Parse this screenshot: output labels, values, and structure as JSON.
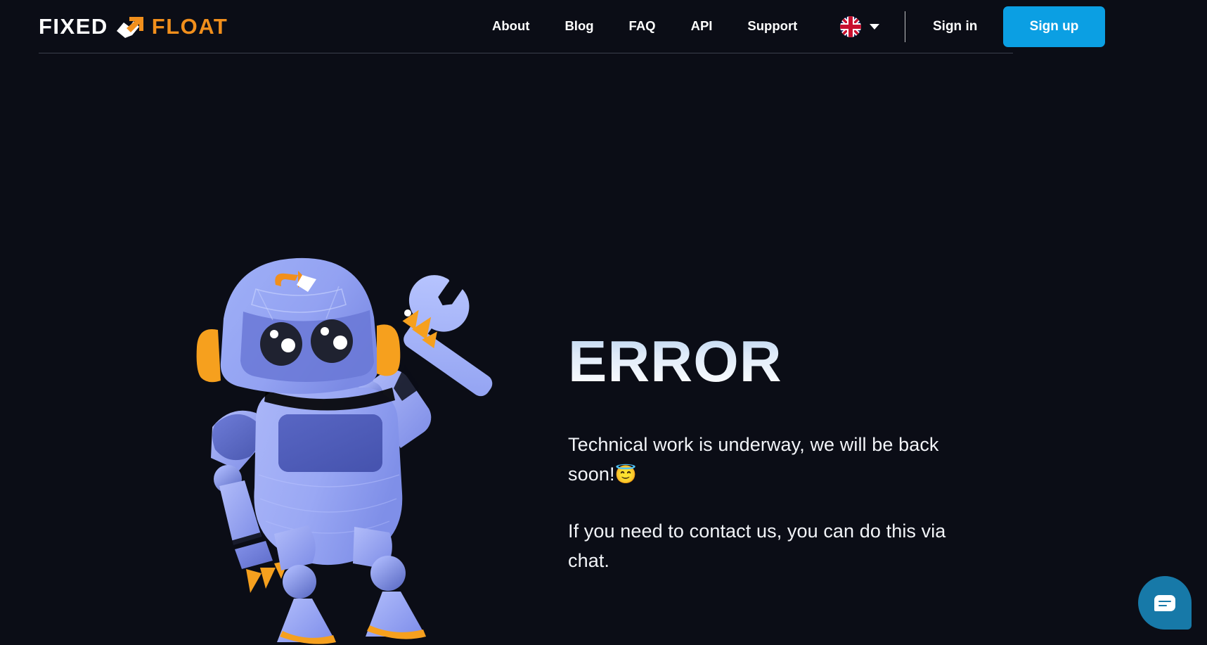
{
  "header": {
    "logo": {
      "fixed_text": "FIXED",
      "float_text": "FLOAT",
      "mark_icon": "arrow-exchange-icon"
    },
    "nav": [
      {
        "label": "About"
      },
      {
        "label": "Blog"
      },
      {
        "label": "FAQ"
      },
      {
        "label": "API"
      },
      {
        "label": "Support"
      }
    ],
    "language": {
      "selected": "EN",
      "flag_icon": "uk-flag-icon",
      "chevron_icon": "chevron-down-icon"
    },
    "sign_in_label": "Sign in",
    "sign_up_label": "Sign up"
  },
  "main": {
    "title": "ERROR",
    "paragraph_1": "Technical work is underway, we will be back soon!",
    "paragraph_1_emoji": "😇",
    "paragraph_2": "If you need to contact us, you can do this via chat.",
    "illustration_icon": "robot-with-wrench-illustration"
  },
  "chat": {
    "button_icon": "chat-bubble-icon",
    "button_label": "Chat"
  },
  "colors": {
    "background": "#0b0d16",
    "accent_orange": "#f18f1c",
    "accent_blue": "#0b9fe3",
    "chat_blue": "#1779a8",
    "text_white": "#ffffff",
    "robot_body": "#97a6f5",
    "robot_dark": "#5b6ad4"
  }
}
